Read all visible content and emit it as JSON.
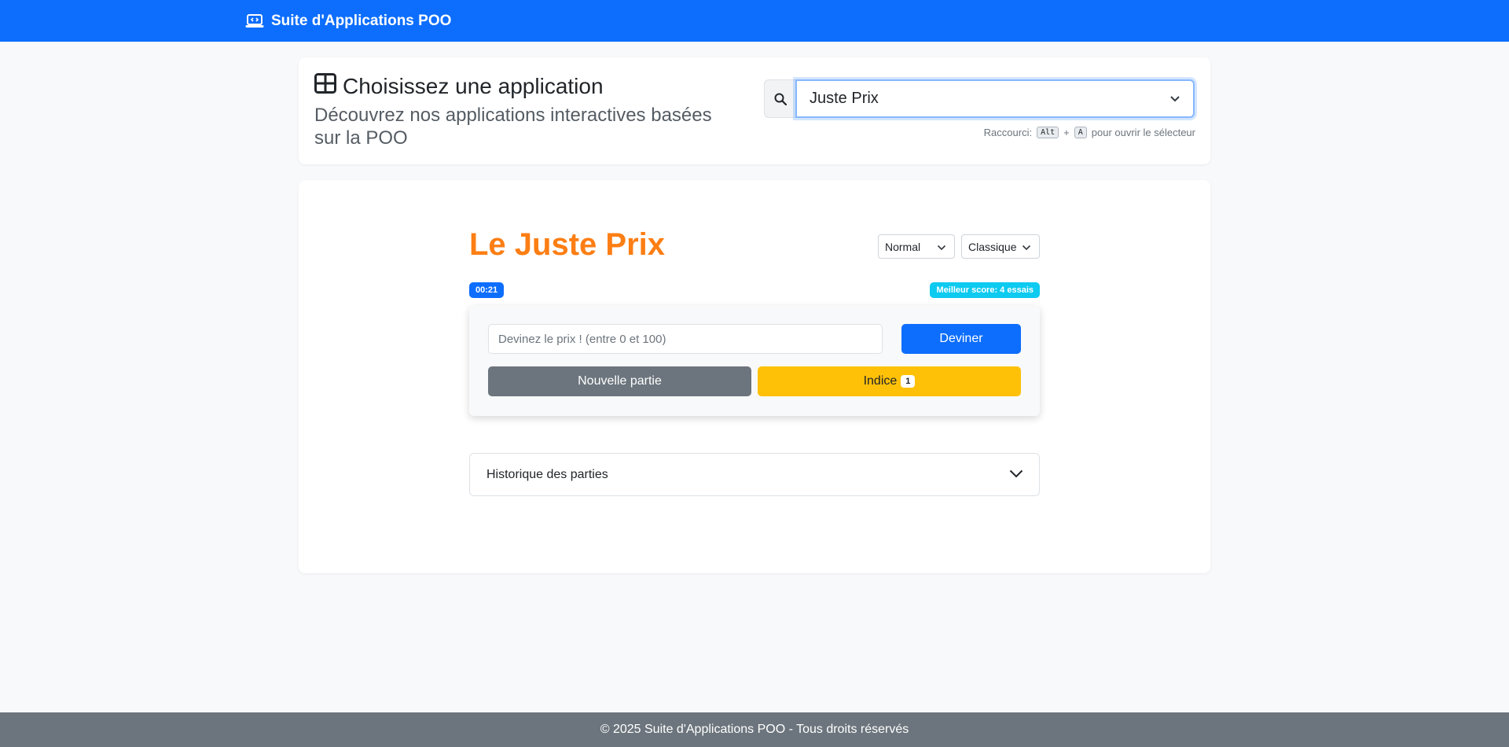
{
  "navbar": {
    "brand": "Suite d'Applications POO",
    "brand_icon": "laptop-code-icon"
  },
  "selector": {
    "title": "Choisissez une application",
    "title_icon": "grid-icon",
    "subtitle": "Découvrez nos applications interactives basées sur la POO",
    "selected_app": "Juste Prix",
    "shortcut": {
      "prefix": "Raccourci:",
      "key1": "Alt",
      "plus": "+",
      "key2": "A",
      "suffix": "pour ouvrir le sélecteur"
    }
  },
  "game": {
    "title": "Le Juste Prix",
    "difficulty": "Normal",
    "mode": "Classique",
    "timer": "00:21",
    "best_score": "Meilleur score: 4 essais",
    "input_placeholder": "Devinez le prix ! (entre 0 et 100)",
    "input_value": "",
    "guess_label": "Deviner",
    "new_game_label": "Nouvelle partie",
    "hint_label": "Indice",
    "hint_count": "1"
  },
  "history": {
    "label": "Historique des parties"
  },
  "footer": {
    "text": "© 2025 Suite d'Applications POO - Tous droits réservés"
  },
  "colors": {
    "primary": "#0d6efd",
    "title_orange": "#fd7e14",
    "info": "#0dcaf0",
    "warning": "#ffc107",
    "secondary": "#6c757d"
  }
}
